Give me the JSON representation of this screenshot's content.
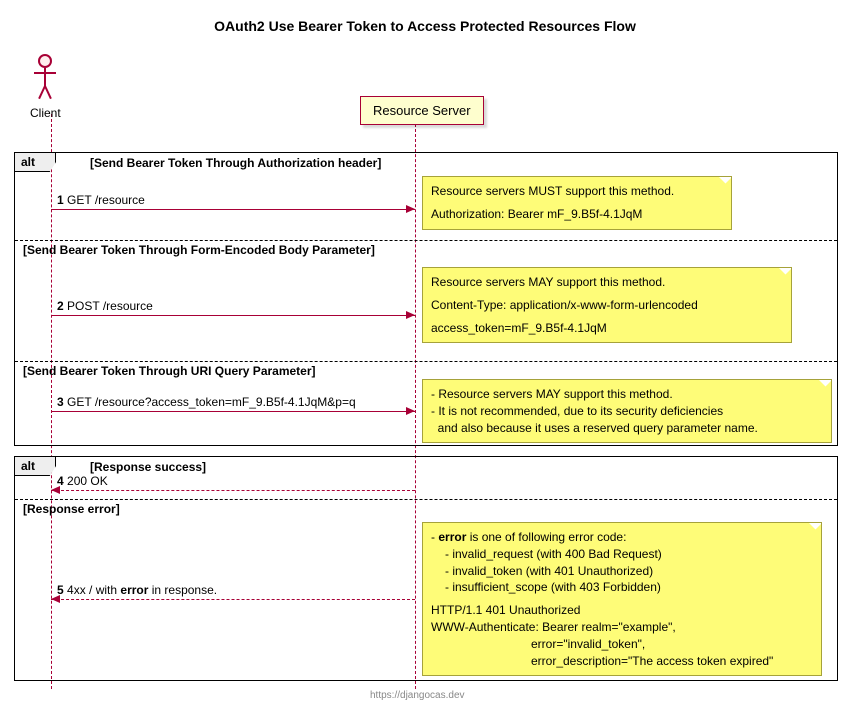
{
  "title": "OAuth2 Use Bearer Token to Access Protected Resources Flow",
  "actors": {
    "client": "Client",
    "server": "Resource Server"
  },
  "alt1": {
    "label": "alt",
    "guard1": "[Send Bearer Token Through Authorization header]",
    "msg1_num": "1",
    "msg1_text": "GET /resource",
    "note1_l1": "Resource servers MUST support this method.",
    "note1_l2": "Authorization: Bearer mF_9.B5f-4.1JqM",
    "guard2": "[Send Bearer Token Through Form-Encoded Body Parameter]",
    "msg2_num": "2",
    "msg2_text": "POST /resource",
    "note2_l1": "Resource servers MAY support this method.",
    "note2_l2": "Content-Type: application/x-www-form-urlencoded",
    "note2_l3": "access_token=mF_9.B5f-4.1JqM",
    "guard3": "[Send Bearer Token Through URI Query Parameter]",
    "msg3_num": "3",
    "msg3_text": "GET /resource?access_token=mF_9.B5f-4.1JqM&p=q",
    "note3_l1": "- Resource servers MAY support this method.",
    "note3_l2": "- It is not recommended, due to its security deficiencies",
    "note3_l3": "  and also because it uses a reserved query parameter name."
  },
  "alt2": {
    "label": "alt",
    "guard1": "[Response success]",
    "msg4_num": "4",
    "msg4_text": "200 OK",
    "guard2": "[Response error]",
    "msg5_num": "5",
    "msg5_text_pre": "4xx / with ",
    "msg5_text_bold": "error",
    "msg5_text_post": " in response.",
    "note_l1_pre": "- ",
    "note_l1_bold": "error",
    "note_l1_post": " is one of following error code:",
    "note_l2": "- invalid_request (with 400 Bad Request)",
    "note_l3": "- invalid_token (with 401 Unauthorized)",
    "note_l4": "- insufficient_scope (with 403 Forbidden)",
    "note_l5": "HTTP/1.1 401 Unauthorized",
    "note_l6": "WWW-Authenticate: Bearer realm=\"example\",",
    "note_l7": "error=\"invalid_token\",",
    "note_l8": "error_description=\"The access token expired\""
  },
  "footer": "https://djangocas.dev"
}
